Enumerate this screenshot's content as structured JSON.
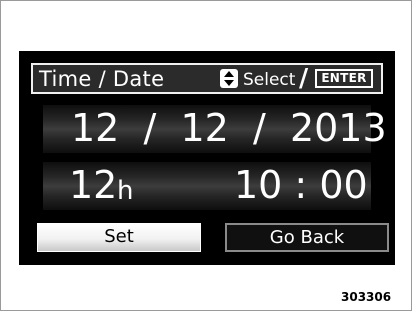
{
  "screen": {
    "title": "Time / Date",
    "hint": {
      "select_label": "Select",
      "separator": "/",
      "enter_label": "ENTER",
      "select_icon": "up-down-arrows-icon"
    },
    "date": {
      "display": "12  /  12  /  2013",
      "month": "12",
      "day": "12",
      "year": "2013"
    },
    "time": {
      "hour": "12",
      "hour_unit": "h",
      "minute_display": "10 : 00"
    },
    "buttons": {
      "set_label": "Set",
      "go_back_label": "Go Back"
    }
  },
  "figure_code": "303306",
  "colors": {
    "screen_background": "#000000",
    "text": "#ffffff",
    "selected_button": "#ffffff"
  }
}
